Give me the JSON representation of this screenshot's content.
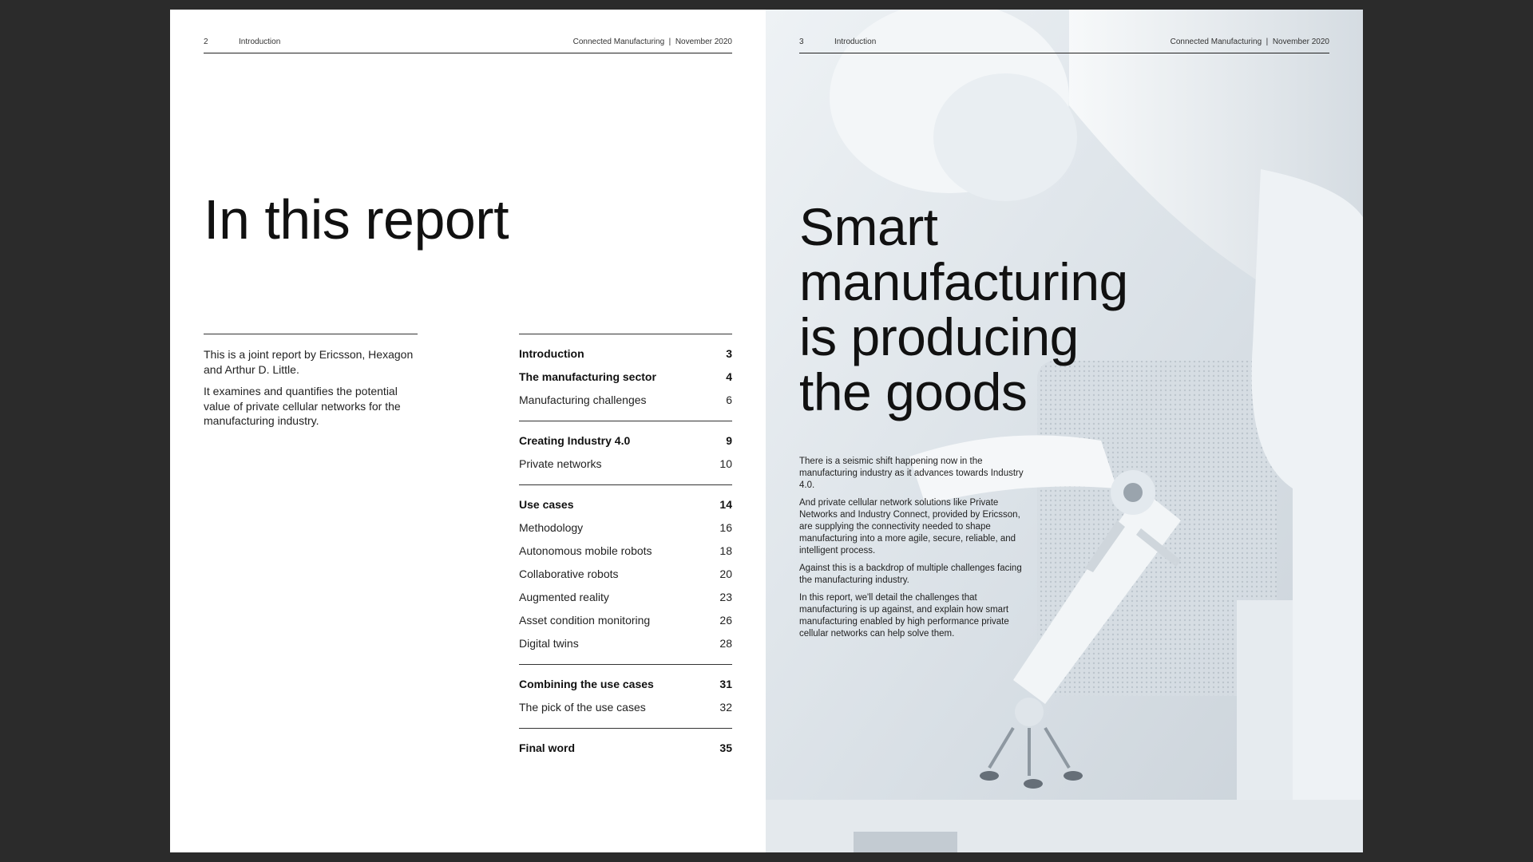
{
  "left_page": {
    "header": {
      "page_number": "2",
      "section": "Introduction",
      "publication": "Connected Manufacturing  |  November 2020"
    },
    "title": "In this report",
    "intro": [
      "This is a joint report by Ericsson, Hexagon and Arthur D. Little.",
      "It examines and quantifies the potential value of private cellular networks for the manufacturing industry."
    ],
    "toc": {
      "groups": [
        {
          "items": [
            {
              "label": "Introduction",
              "page": "3",
              "bold": true
            },
            {
              "label": "The manufacturing sector",
              "page": "4",
              "bold": true
            },
            {
              "label": "Manufacturing challenges",
              "page": "6",
              "bold": false
            }
          ]
        },
        {
          "items": [
            {
              "label": "Creating Industry 4.0",
              "page": "9",
              "bold": true
            },
            {
              "label": "Private networks",
              "page": "10",
              "bold": false
            }
          ]
        },
        {
          "items": [
            {
              "label": "Use cases",
              "page": "14",
              "bold": true
            },
            {
              "label": "Methodology",
              "page": "16",
              "bold": false
            },
            {
              "label": "Autonomous mobile robots",
              "page": "18",
              "bold": false
            },
            {
              "label": "Collaborative robots",
              "page": "20",
              "bold": false
            },
            {
              "label": "Augmented reality",
              "page": "23",
              "bold": false
            },
            {
              "label": "Asset condition monitoring",
              "page": "26",
              "bold": false
            },
            {
              "label": "Digital twins",
              "page": "28",
              "bold": false
            }
          ]
        },
        {
          "items": [
            {
              "label": "Combining the use cases",
              "page": "31",
              "bold": true
            },
            {
              "label": "The pick of the use cases",
              "page": "32",
              "bold": false
            }
          ]
        },
        {
          "items": [
            {
              "label": "Final word",
              "page": "35",
              "bold": true
            }
          ]
        }
      ]
    }
  },
  "right_page": {
    "header": {
      "page_number": "3",
      "section": "Introduction",
      "publication": "Connected Manufacturing  |  November 2020"
    },
    "title_lines": [
      "Smart",
      "manufacturing",
      "is producing",
      "the goods"
    ],
    "paragraphs": [
      "There is a seismic shift happening now in the manufacturing industry as it advances towards Industry 4.0.",
      "And private cellular network solutions like Private Networks and Industry Connect, provided by Ericsson, are supplying the connectivity needed to shape manufacturing into a more agile, secure, reliable, and intelligent process.",
      "Against this is a backdrop of multiple challenges facing the manufacturing industry.",
      "In this report, we'll detail the challenges that manufacturing is up against, and explain how smart manufacturing enabled by high performance private cellular networks can help solve them."
    ],
    "image_subject": "robot-arm-photo"
  },
  "colors": {
    "background": "#2b2b2b",
    "page": "#ffffff",
    "photo_tint": "#dfe6ec",
    "text": "#111111"
  }
}
